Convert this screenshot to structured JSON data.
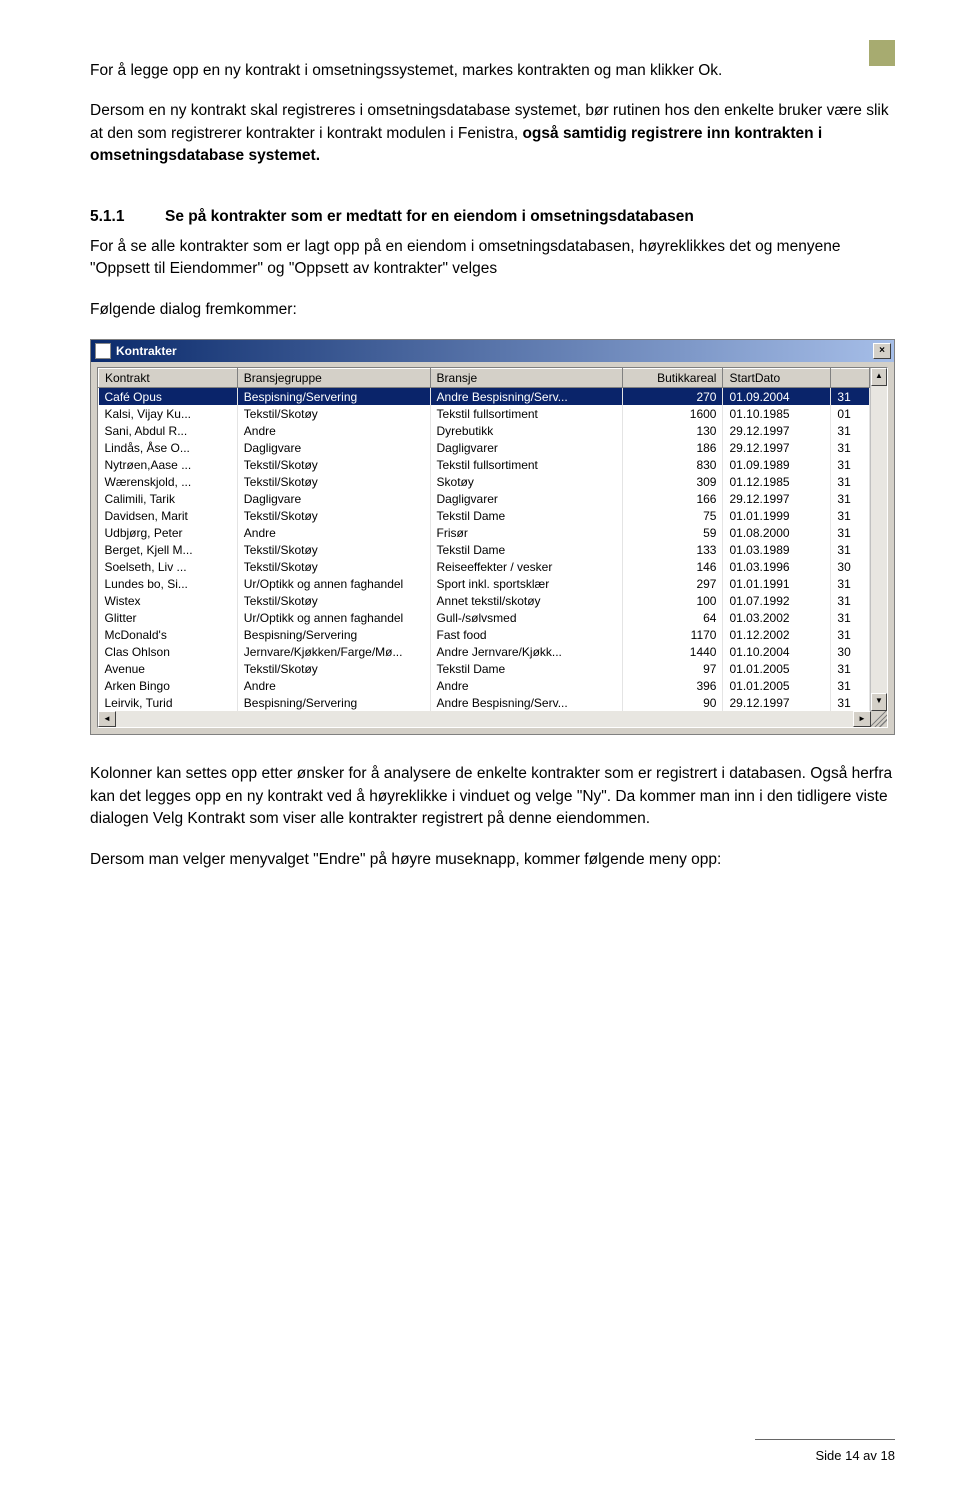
{
  "para1": "For å legge opp en ny kontrakt i omsetningssystemet, markes kontrakten og man klikker Ok.",
  "para2_a": "Dersom en ny kontrakt skal registreres i omsetningsdatabase systemet, bør rutinen hos den enkelte bruker være slik at den som registrerer kontrakter i kontrakt modulen i Fenistra, ",
  "para2_b": "også samtidig registrere inn kontrakten i omsetningsdatabase systemet.",
  "sec_num": "5.1.1",
  "sec_title": "Se på kontrakter som er medtatt for en eiendom i omsetningsdatabasen",
  "para3": "For å se alle kontrakter som er lagt opp på en eiendom i omsetningsdatabasen, høyreklikkes det og menyene \"Oppsett til Eiendommer\" og \"Oppsett av kontrakter\" velges",
  "para4": "Følgende dialog fremkommer:",
  "dialog_title": "Kontrakter",
  "headers": [
    "Kontrakt",
    "Bransjegruppe",
    "Bransje",
    "Butikkareal",
    "StartDato",
    ""
  ],
  "rows": [
    {
      "c": [
        "Café Opus",
        "Bespisning/Servering",
        "Andre Bespisning/Serv...",
        "270",
        "01.09.2004",
        "31"
      ],
      "sel": true
    },
    {
      "c": [
        "Kalsi, Vijay Ku...",
        "Tekstil/Skotøy",
        "Tekstil fullsortiment",
        "1600",
        "01.10.1985",
        "01"
      ]
    },
    {
      "c": [
        "Sani, Abdul R...",
        "Andre",
        "Dyrebutikk",
        "130",
        "29.12.1997",
        "31"
      ]
    },
    {
      "c": [
        "Lindås, Åse O...",
        "Dagligvare",
        "Dagligvarer",
        "186",
        "29.12.1997",
        "31"
      ]
    },
    {
      "c": [
        "Nytrøen,Aase ...",
        "Tekstil/Skotøy",
        "Tekstil fullsortiment",
        "830",
        "01.09.1989",
        "31"
      ]
    },
    {
      "c": [
        "Wærenskjold, ...",
        "Tekstil/Skotøy",
        "Skotøy",
        "309",
        "01.12.1985",
        "31"
      ]
    },
    {
      "c": [
        "Calimili, Tarik",
        "Dagligvare",
        "Dagligvarer",
        "166",
        "29.12.1997",
        "31"
      ]
    },
    {
      "c": [
        "Davidsen, Marit",
        "Tekstil/Skotøy",
        "Tekstil Dame",
        "75",
        "01.01.1999",
        "31"
      ]
    },
    {
      "c": [
        "Udbjørg, Peter",
        "Andre",
        "Frisør",
        "59",
        "01.08.2000",
        "31"
      ]
    },
    {
      "c": [
        "Berget, Kjell M...",
        "Tekstil/Skotøy",
        "Tekstil Dame",
        "133",
        "01.03.1989",
        "31"
      ]
    },
    {
      "c": [
        "Soelseth, Liv ...",
        "Tekstil/Skotøy",
        "Reiseeffekter / vesker",
        "146",
        "01.03.1996",
        "30"
      ]
    },
    {
      "c": [
        "Lundes bo, Si...",
        "Ur/Optikk og annen faghandel",
        "Sport inkl. sportsklær",
        "297",
        "01.01.1991",
        "31"
      ]
    },
    {
      "c": [
        "Wistex",
        "Tekstil/Skotøy",
        "Annet tekstil/skotøy",
        "100",
        "01.07.1992",
        "31"
      ]
    },
    {
      "c": [
        "Glitter",
        "Ur/Optikk og annen faghandel",
        "Gull-/sølvsmed",
        "64",
        "01.03.2002",
        "31"
      ]
    },
    {
      "c": [
        "McDonald's",
        "Bespisning/Servering",
        "Fast food",
        "1170",
        "01.12.2002",
        "31"
      ]
    },
    {
      "c": [
        "Clas Ohlson",
        "Jernvare/Kjøkken/Farge/Mø...",
        "Andre Jernvare/Kjøkk...",
        "1440",
        "01.10.2004",
        "30"
      ]
    },
    {
      "c": [
        "Avenue",
        "Tekstil/Skotøy",
        "Tekstil Dame",
        "97",
        "01.01.2005",
        "31"
      ]
    },
    {
      "c": [
        "Arken Bingo",
        "Andre",
        "Andre",
        "396",
        "01.01.2005",
        "31"
      ]
    },
    {
      "c": [
        "Leirvik, Turid",
        "Bespisning/Servering",
        "Andre Bespisning/Serv...",
        "90",
        "29.12.1997",
        "31"
      ]
    }
  ],
  "para5": "Kolonner kan settes opp etter ønsker for å analysere de enkelte kontrakter som er registrert i databasen. Også herfra kan det legges opp en ny kontrakt ved å høyreklikke i vinduet og velge \"Ny\". Da kommer man inn i den tidligere viste dialogen Velg Kontrakt som viser alle kontrakter registrert på denne eiendommen.",
  "para6": "Dersom man velger menyvalget \"Endre\" på høyre museknapp, kommer følgende meny opp:",
  "footer": "Side 14 av 18"
}
